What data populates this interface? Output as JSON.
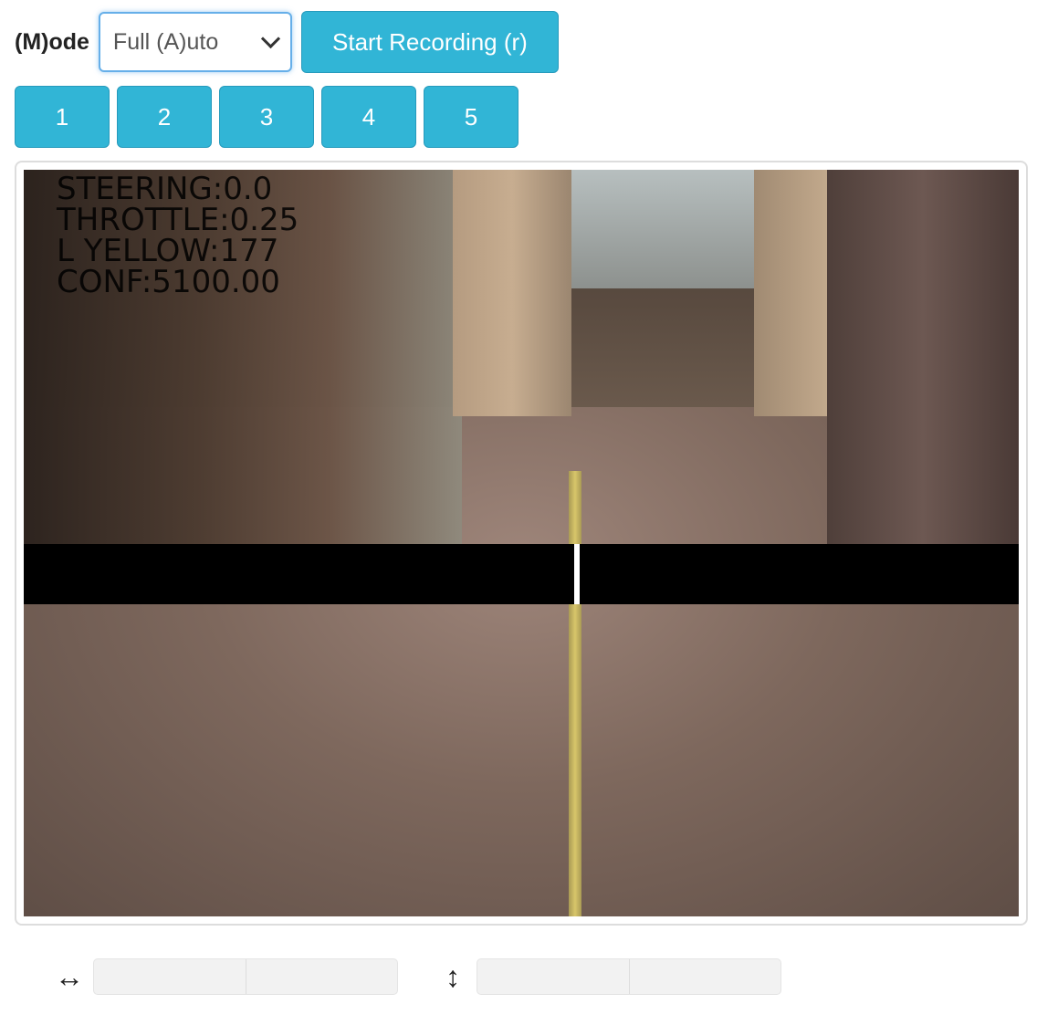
{
  "toolbar": {
    "mode_label": "(M)ode",
    "mode_value": "Full (A)uto",
    "record_label": "Start Recording (r)"
  },
  "number_buttons": [
    "1",
    "2",
    "3",
    "4",
    "5"
  ],
  "video": {
    "overlay_lines": [
      "STEERING:0.0",
      "THROTTLE:0.25",
      "L YELLOW:177",
      "CONF:5100.00"
    ]
  },
  "controls": {
    "horizontal_icon": "↔",
    "vertical_icon": "↕"
  },
  "colors": {
    "button": "#31b5d6",
    "select_border": "#66afe9"
  }
}
